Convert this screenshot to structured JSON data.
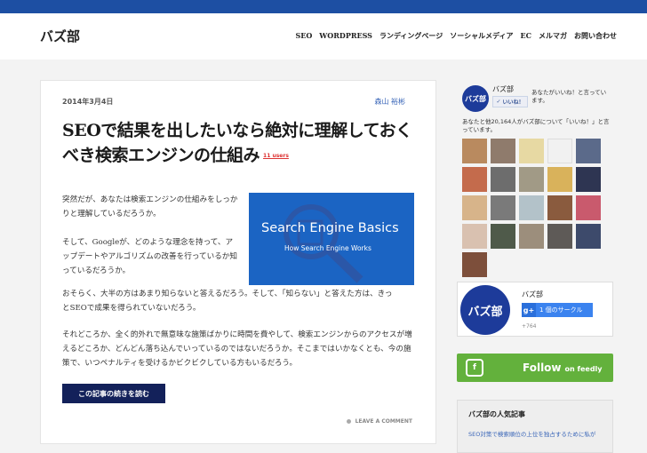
{
  "colors": {
    "topbar": "#1d4fa3",
    "accent": "#13215a",
    "feedly": "#63b13c",
    "link": "#3a66b8"
  },
  "header": {
    "logo": "バズ部",
    "nav": [
      "SEO",
      "WORDPRESS",
      "ランディングページ",
      "ソーシャルメディア",
      "EC",
      "メルマガ",
      "お問い合わせ"
    ]
  },
  "article": {
    "date": "2014年3月4日",
    "author": "森山 裕彬",
    "title": "SEOで結果を出したいなら絶対に理解しておくべき検索エンジンの仕組み",
    "users_badge": "11 users",
    "paragraphs": [
      "突然だが、あなたは検索エンジンの仕組みをしっかりと理解しているだろうか。",
      "そして、Googleが、どのような理念を持って、アップデートやアルゴリズムの改善を行っているか知っているだろうか。",
      "おそらく、大半の方はあまり知らないと答えるだろう。そして、「知らない」と答えた方は、きっとSEOで成果を得られていないだろう。",
      "それどころか、全く的外れで無意味な施策ばかりに時間を費やして、検索エンジンからのアクセスが増えるどころか、どんどん落ち込んでいっているのではないだろうか。そこまではいかなくとも、今の施策で、いつペナルティを受けるかビクビクしている方もいるだろう。"
    ],
    "image": {
      "title": "Search Engine Basics",
      "subtitle": "How Search Engine Works",
      "icon": "magnifier-icon"
    },
    "read_more": "この記事の続きを読む",
    "comment": "LEAVE A COMMENT"
  },
  "sidebar": {
    "facebook": {
      "page_name": "バズ部",
      "avatar_text": "バズ部",
      "like_button": "いいね！",
      "like_desc": "あなたがいいね！と言っています。",
      "count_text": "あなたと他20,164人がバズ部について「いいね！」と言っています。"
    },
    "gplus": {
      "avatar_text": "バズ部",
      "name": "バズ部",
      "button": "1 個のサークル",
      "count": "+764"
    },
    "feedly": {
      "label": "Follow",
      "suffix": "on feedly"
    },
    "popular": {
      "title": "バズ部の人気記事",
      "first_item": "SEO対策で検索順位の上位を独占するために私が"
    }
  }
}
